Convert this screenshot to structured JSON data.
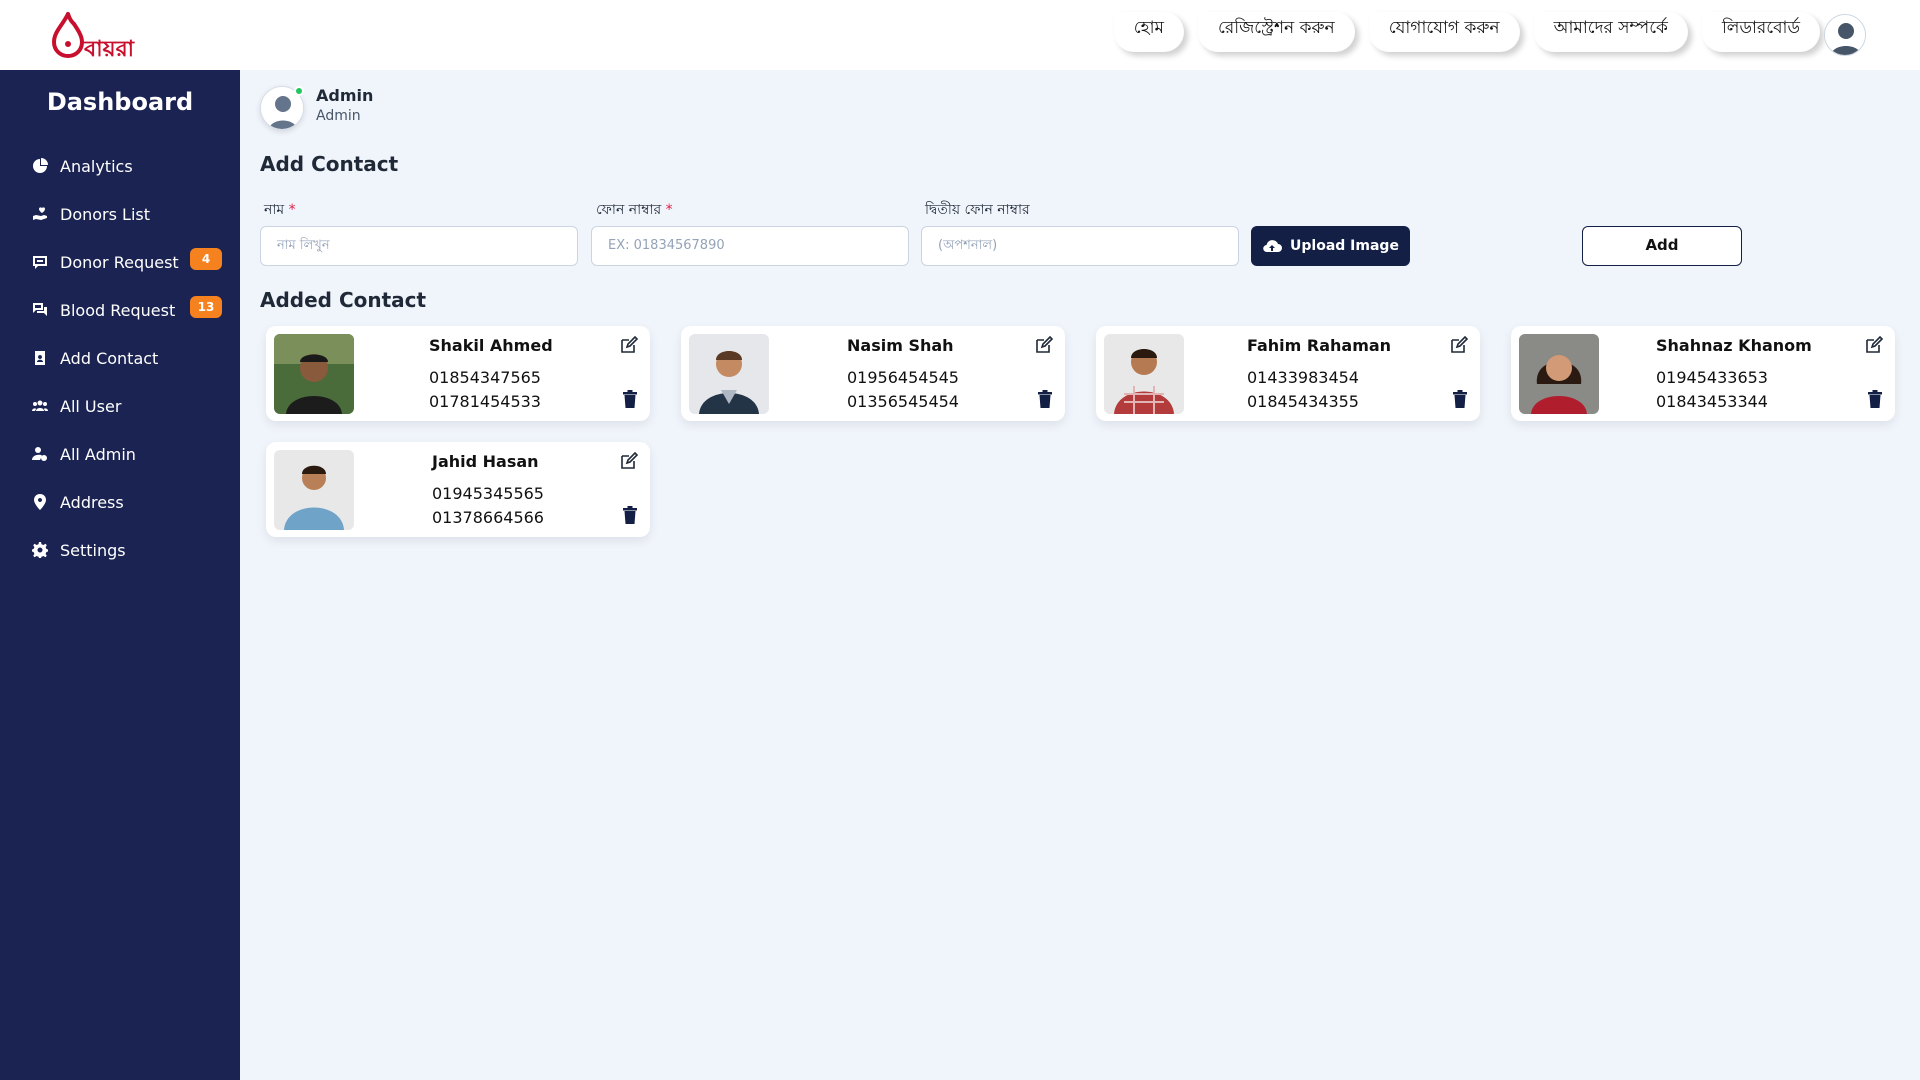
{
  "brand": {
    "logo_text": "বায়রা",
    "color": "#c8102e"
  },
  "nav": [
    {
      "label": "হোম"
    },
    {
      "label": "রেজিস্ট্রেশন করুন"
    },
    {
      "label": "যোগাযোগ করুন"
    },
    {
      "label": "আমাদের সম্পর্কে"
    },
    {
      "label": "লিডারবোর্ড"
    }
  ],
  "sidebar": {
    "title": "Dashboard",
    "items": [
      {
        "label": "Analytics",
        "icon": "pie-chart-icon"
      },
      {
        "label": "Donors List",
        "icon": "hand-heart-icon"
      },
      {
        "label": "Donor Request",
        "icon": "message-icon",
        "badge": "4"
      },
      {
        "label": "Blood Request",
        "icon": "chat-icon",
        "badge": "13"
      },
      {
        "label": "Add Contact",
        "icon": "contact-book-icon"
      },
      {
        "label": "All User",
        "icon": "users-icon"
      },
      {
        "label": "All Admin",
        "icon": "user-gear-icon"
      },
      {
        "label": "Address",
        "icon": "location-pin-icon"
      },
      {
        "label": "Settings",
        "icon": "gear-icon"
      }
    ]
  },
  "admin": {
    "name": "Admin",
    "role": "Admin"
  },
  "form": {
    "title": "Add Contact",
    "name_label": "নাম",
    "name_placeholder": "নাম লিখুন",
    "phone_label": "ফোন নাম্বার",
    "phone_placeholder": "EX: 01834567890",
    "phone2_label": "দ্বিতীয় ফোন নাম্বার",
    "phone2_placeholder": "(অপশনাল)",
    "required_mark": "*",
    "upload_label": "Upload Image",
    "add_label": "Add"
  },
  "contacts_title": "Added Contact",
  "contacts": [
    {
      "name": "Shakil Ahmed",
      "phone1": "01854347565",
      "phone2": "01781454533"
    },
    {
      "name": "Nasim Shah",
      "phone1": "01956454545",
      "phone2": "01356545454"
    },
    {
      "name": "Fahim Rahaman",
      "phone1": "01433983454",
      "phone2": "01845434355"
    },
    {
      "name": "Shahnaz Khanom",
      "phone1": "01945433653",
      "phone2": "01843453344"
    },
    {
      "name": "Jahid Hasan",
      "phone1": "01945345565",
      "phone2": "01378664566"
    }
  ],
  "colors": {
    "sidebar": "#1a2352",
    "badge": "#f6821f",
    "button_dark": "#141f46"
  }
}
